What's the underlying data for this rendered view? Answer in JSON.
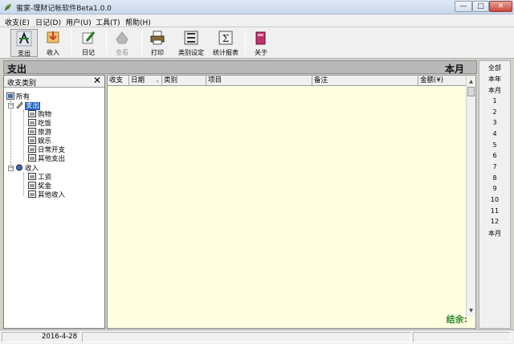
{
  "window": {
    "title": "蜜家-理财记帐软件Beta1.0.0",
    "min_glyph": "—",
    "max_glyph": "□",
    "close_glyph": "✕"
  },
  "menu": [
    "收支(E)",
    "日记(D)",
    "用户(U)",
    "工具(T)",
    "帮助(H)"
  ],
  "toolbar": [
    {
      "label": "支出",
      "icon": "expense-icon",
      "pressed": true
    },
    {
      "label": "收入",
      "icon": "income-icon"
    },
    {
      "label": "日记",
      "icon": "diary-icon"
    },
    {
      "label": "查看",
      "icon": "view-icon",
      "disabled": true
    },
    {
      "label": "打印",
      "icon": "print-icon"
    },
    {
      "label": "类别设定",
      "icon": "category-settings-icon"
    },
    {
      "label": "统计报表",
      "icon": "statistics-report-icon"
    },
    {
      "label": "关于",
      "icon": "about-icon"
    }
  ],
  "header": {
    "left": "支出",
    "right": "本月"
  },
  "tree": {
    "title": "收支类别",
    "close": "✕",
    "root": "所有",
    "groups": [
      {
        "label": "支出",
        "items": [
          "购物",
          "吃饭",
          "旅游",
          "娱乐",
          "日常开支",
          "其他支出"
        ]
      },
      {
        "label": "收入",
        "items": [
          "工资",
          "奖金",
          "其他收入"
        ]
      }
    ]
  },
  "table": {
    "columns": [
      "收支",
      "日期",
      "类别",
      "项目",
      "备注",
      "金额(¥)"
    ],
    "rows": [],
    "balance_label": "结余:"
  },
  "periods": [
    "全部",
    "本年",
    "本月",
    "1",
    "2",
    "3",
    "4",
    "5",
    "6",
    "7",
    "8",
    "9",
    "10",
    "11",
    "12",
    "本月"
  ],
  "status": {
    "date": "2016-4-28"
  },
  "colors": {
    "selection": "#1e5fc0",
    "grid_bg": "#ffffe1",
    "balance_text": "#2c8a2c"
  }
}
